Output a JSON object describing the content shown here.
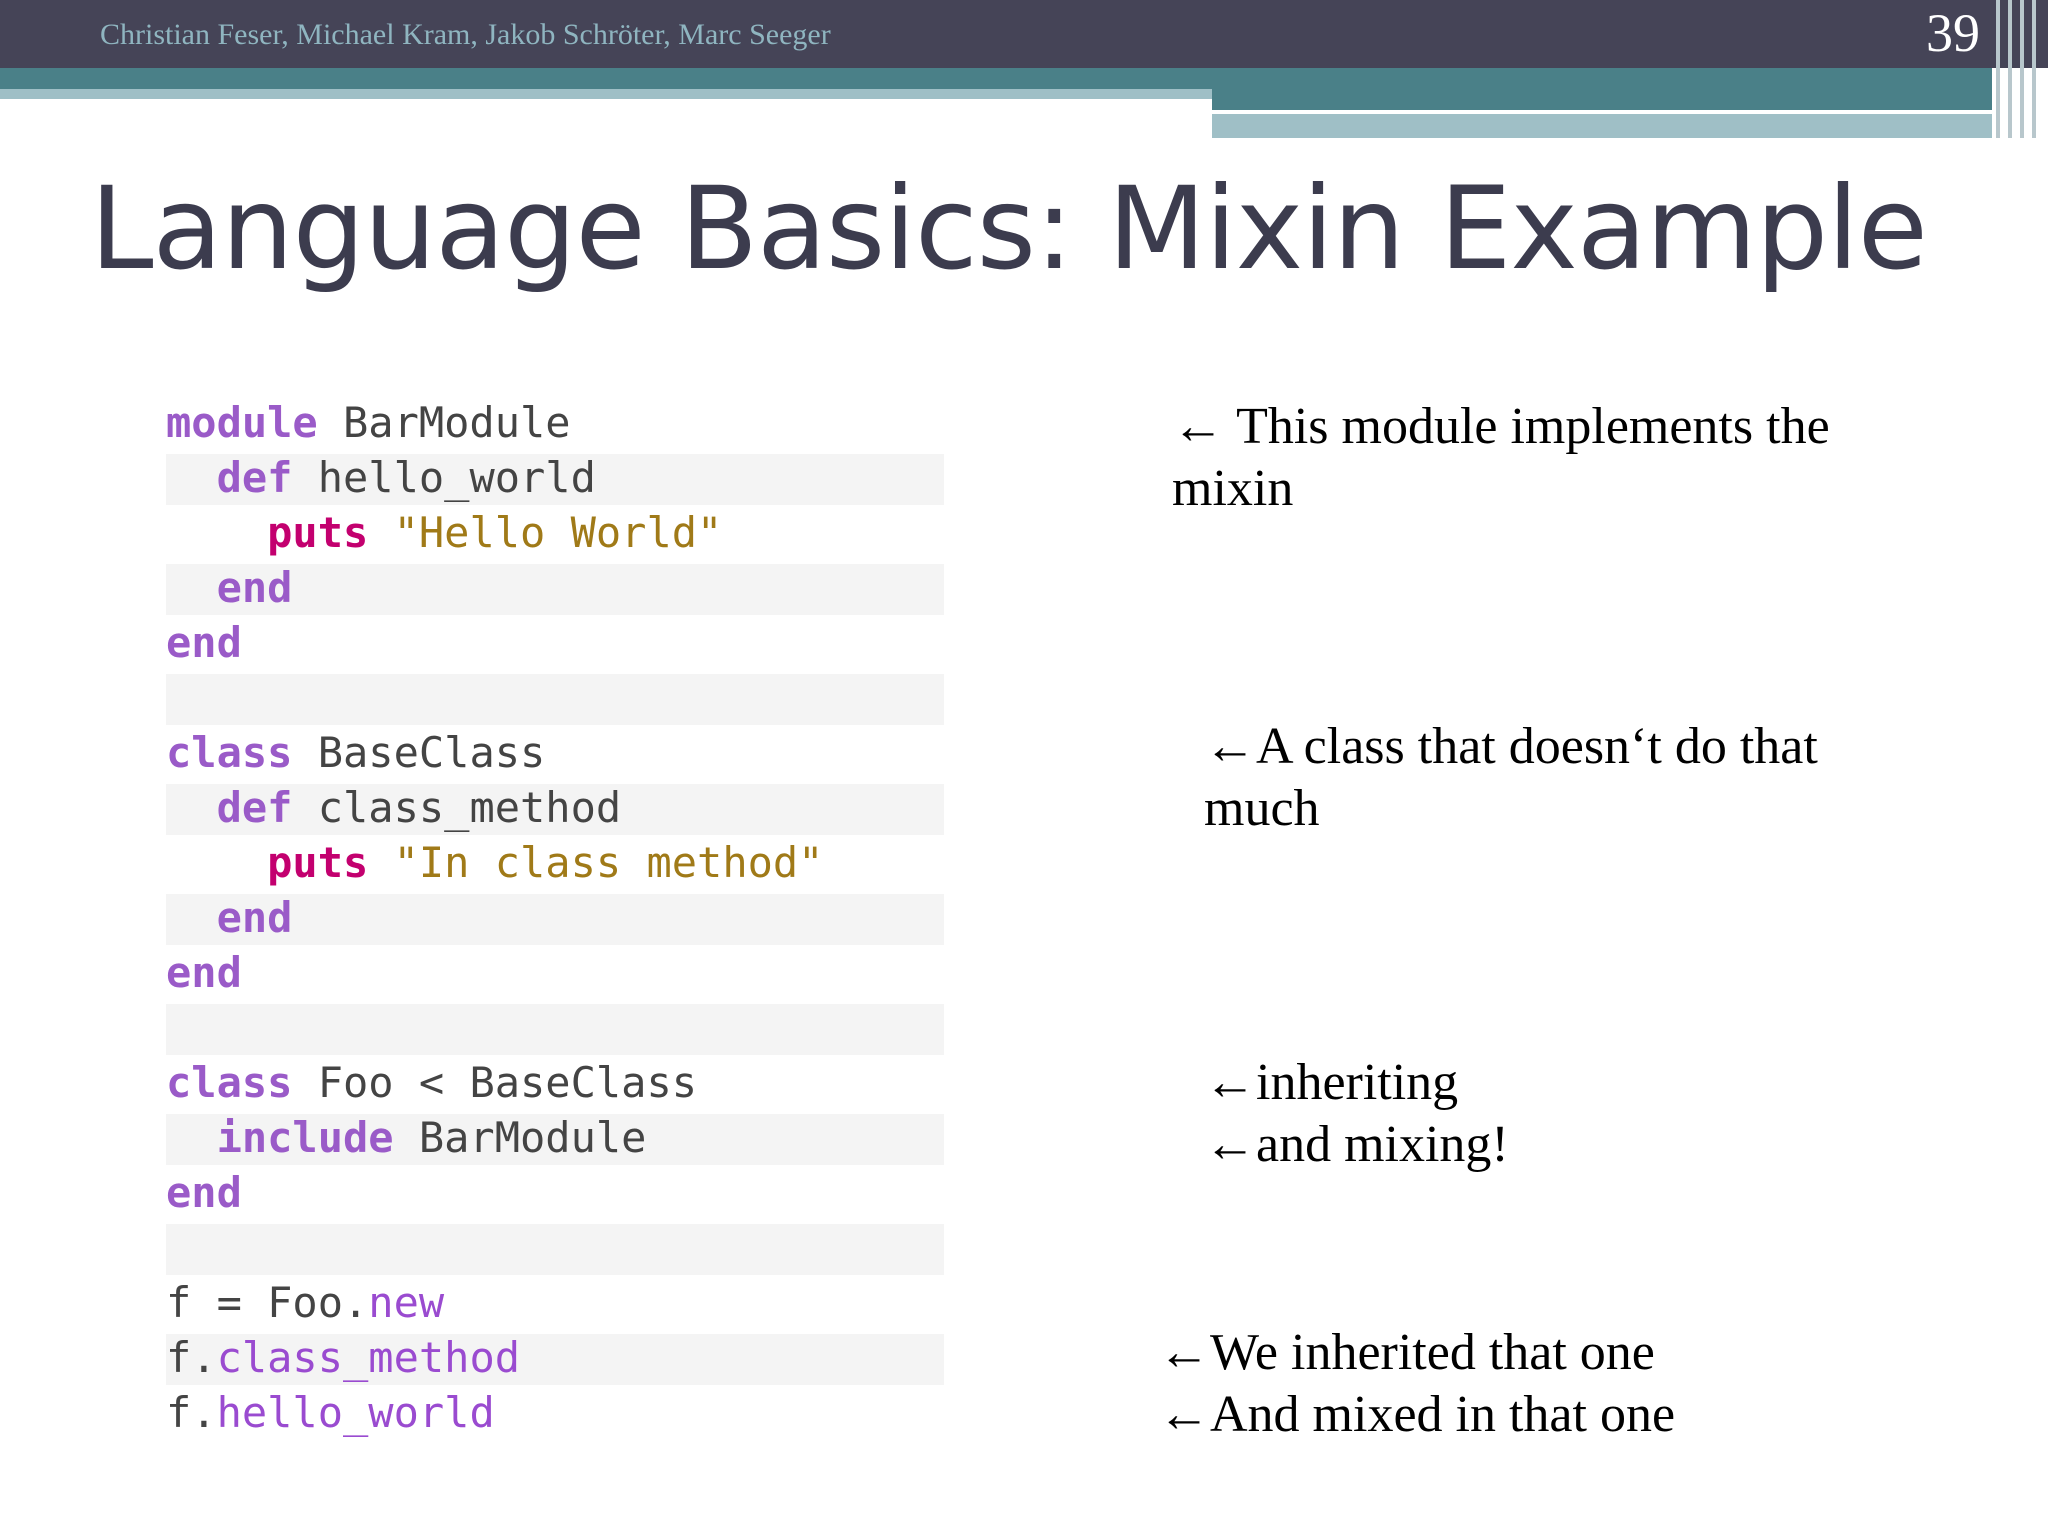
{
  "header": {
    "authors": "Christian Feser, Michael Kram, Jakob Schröter, Marc Seeger",
    "page_number": "39"
  },
  "slide": {
    "title": "Language Basics: Mixin Example"
  },
  "code_lines": [
    {
      "shade": false,
      "tokens": [
        {
          "t": "module",
          "c": "kw"
        },
        {
          "t": " BarModule",
          "c": ""
        }
      ]
    },
    {
      "shade": true,
      "tokens": [
        {
          "t": "  def",
          "c": "kw"
        },
        {
          "t": " hello_world",
          "c": ""
        }
      ]
    },
    {
      "shade": false,
      "tokens": [
        {
          "t": "    puts",
          "c": "pk"
        },
        {
          "t": " ",
          "c": ""
        },
        {
          "t": "\"Hello World\"",
          "c": "st"
        }
      ]
    },
    {
      "shade": true,
      "tokens": [
        {
          "t": "  end",
          "c": "kw"
        }
      ]
    },
    {
      "shade": false,
      "tokens": [
        {
          "t": "end",
          "c": "kw"
        }
      ]
    },
    {
      "shade": true,
      "tokens": []
    },
    {
      "shade": false,
      "tokens": [
        {
          "t": "class",
          "c": "kw"
        },
        {
          "t": " BaseClass",
          "c": ""
        }
      ]
    },
    {
      "shade": true,
      "tokens": [
        {
          "t": "  def",
          "c": "kw"
        },
        {
          "t": " class_method",
          "c": ""
        }
      ]
    },
    {
      "shade": false,
      "tokens": [
        {
          "t": "    puts",
          "c": "pk"
        },
        {
          "t": " ",
          "c": ""
        },
        {
          "t": "\"In class method\"",
          "c": "st"
        }
      ]
    },
    {
      "shade": true,
      "tokens": [
        {
          "t": "  end",
          "c": "kw"
        }
      ]
    },
    {
      "shade": false,
      "tokens": [
        {
          "t": "end",
          "c": "kw"
        }
      ]
    },
    {
      "shade": true,
      "tokens": []
    },
    {
      "shade": false,
      "tokens": [
        {
          "t": "class",
          "c": "kw"
        },
        {
          "t": " Foo < BaseClass",
          "c": ""
        }
      ]
    },
    {
      "shade": true,
      "tokens": [
        {
          "t": "  include",
          "c": "kw"
        },
        {
          "t": " BarModule",
          "c": ""
        }
      ]
    },
    {
      "shade": false,
      "tokens": [
        {
          "t": "end",
          "c": "kw"
        }
      ]
    },
    {
      "shade": true,
      "tokens": []
    },
    {
      "shade": false,
      "tokens": [
        {
          "t": "f = Foo.",
          "c": ""
        },
        {
          "t": "new",
          "c": "mc"
        }
      ]
    },
    {
      "shade": true,
      "tokens": [
        {
          "t": "f.",
          "c": ""
        },
        {
          "t": "class_method",
          "c": "mc"
        }
      ]
    },
    {
      "shade": false,
      "tokens": [
        {
          "t": "f.",
          "c": ""
        },
        {
          "t": "hello_world",
          "c": "mc"
        }
      ]
    }
  ],
  "annotations": {
    "a1_line1": "This module implements the",
    "a1_line2": "mixin",
    "a2_line1": "A class that doesn‘t do that",
    "a2_line2": "much",
    "a3_line1": "inheriting",
    "a3_line2": "and mixing!",
    "a4_line1": "We inherited that one",
    "a4_line2": "And mixed in that one",
    "arrow": "←"
  },
  "colors": {
    "header_bg": "#454457",
    "teal_stripe": "#4a8088",
    "light_stripe": "#9fbfc6",
    "keyword": "#9a5bc8",
    "puts": "#c3006f",
    "string": "#a07a18"
  }
}
